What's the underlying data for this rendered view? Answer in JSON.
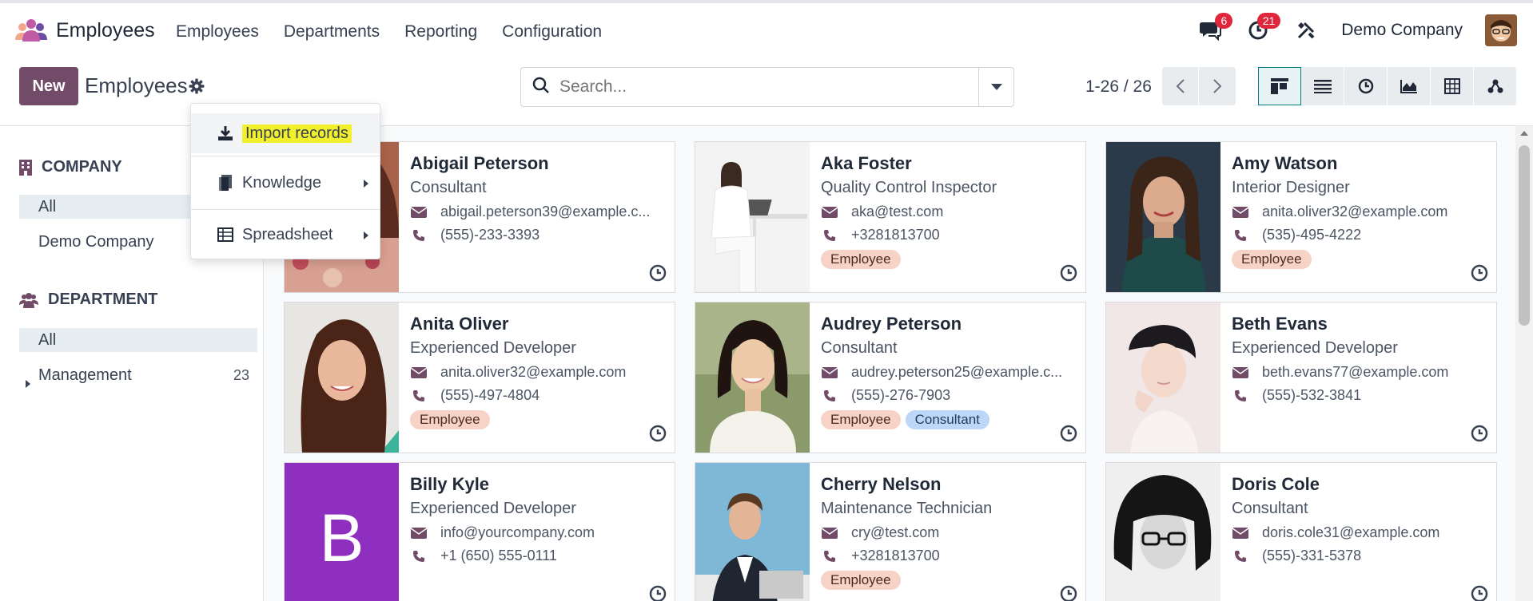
{
  "app": {
    "title": "Employees",
    "menu": [
      "Employees",
      "Departments",
      "Reporting",
      "Configuration"
    ],
    "brand_colors": [
      "#f2a78a",
      "#c05ba6",
      "#6b4ea3"
    ]
  },
  "systray": {
    "messages_count": "6",
    "activities_count": "21",
    "company": "Demo Company"
  },
  "control": {
    "new_label": "New",
    "title": "Employees",
    "search_placeholder": "Search...",
    "pager": "1-26 / 26",
    "accent": "#714b67"
  },
  "dropdown": {
    "import": "Import records",
    "knowledge": "Knowledge",
    "spreadsheet": "Spreadsheet"
  },
  "side": {
    "company_header": "COMPANY",
    "company_items": [
      "All",
      "Demo Company"
    ],
    "department_header": "DEPARTMENT",
    "department_items": [
      {
        "label": "All",
        "count": ""
      },
      {
        "label": "Management",
        "count": "23"
      }
    ]
  },
  "employees": [
    {
      "name": "Abigail Peterson",
      "job": "Consultant",
      "email": "abigail.peterson39@example.c...",
      "phone": "(555)-233-3393",
      "tags": []
    },
    {
      "name": "Aka Foster",
      "job": "Quality Control Inspector",
      "email": "aka@test.com",
      "phone": "+3281813700",
      "tags": [
        "Employee"
      ]
    },
    {
      "name": "Amy Watson",
      "job": "Interior Designer",
      "email": "anita.oliver32@example.com",
      "phone": "(535)-495-4222",
      "tags": [
        "Employee"
      ]
    },
    {
      "name": "Anita Oliver",
      "job": "Experienced Developer",
      "email": "anita.oliver32@example.com",
      "phone": "(555)-497-4804",
      "tags": [
        "Employee"
      ]
    },
    {
      "name": "Audrey Peterson",
      "job": "Consultant",
      "email": "audrey.peterson25@example.c...",
      "phone": "(555)-276-7903",
      "tags": [
        "Employee",
        "Consultant"
      ]
    },
    {
      "name": "Beth Evans",
      "job": "Experienced Developer",
      "email": "beth.evans77@example.com",
      "phone": "(555)-532-3841",
      "tags": []
    },
    {
      "name": "Billy Kyle",
      "job": "Experienced Developer",
      "email": "info@yourcompany.com",
      "phone": "+1 (650) 555-0111",
      "tags": [],
      "initial": "B"
    },
    {
      "name": "Cherry Nelson",
      "job": "Maintenance Technician",
      "email": "cry@test.com",
      "phone": "+3281813700",
      "tags": [
        "Employee"
      ]
    },
    {
      "name": "Doris Cole",
      "job": "Consultant",
      "email": "doris.cole31@example.com",
      "phone": "(555)-331-5378",
      "tags": []
    }
  ]
}
